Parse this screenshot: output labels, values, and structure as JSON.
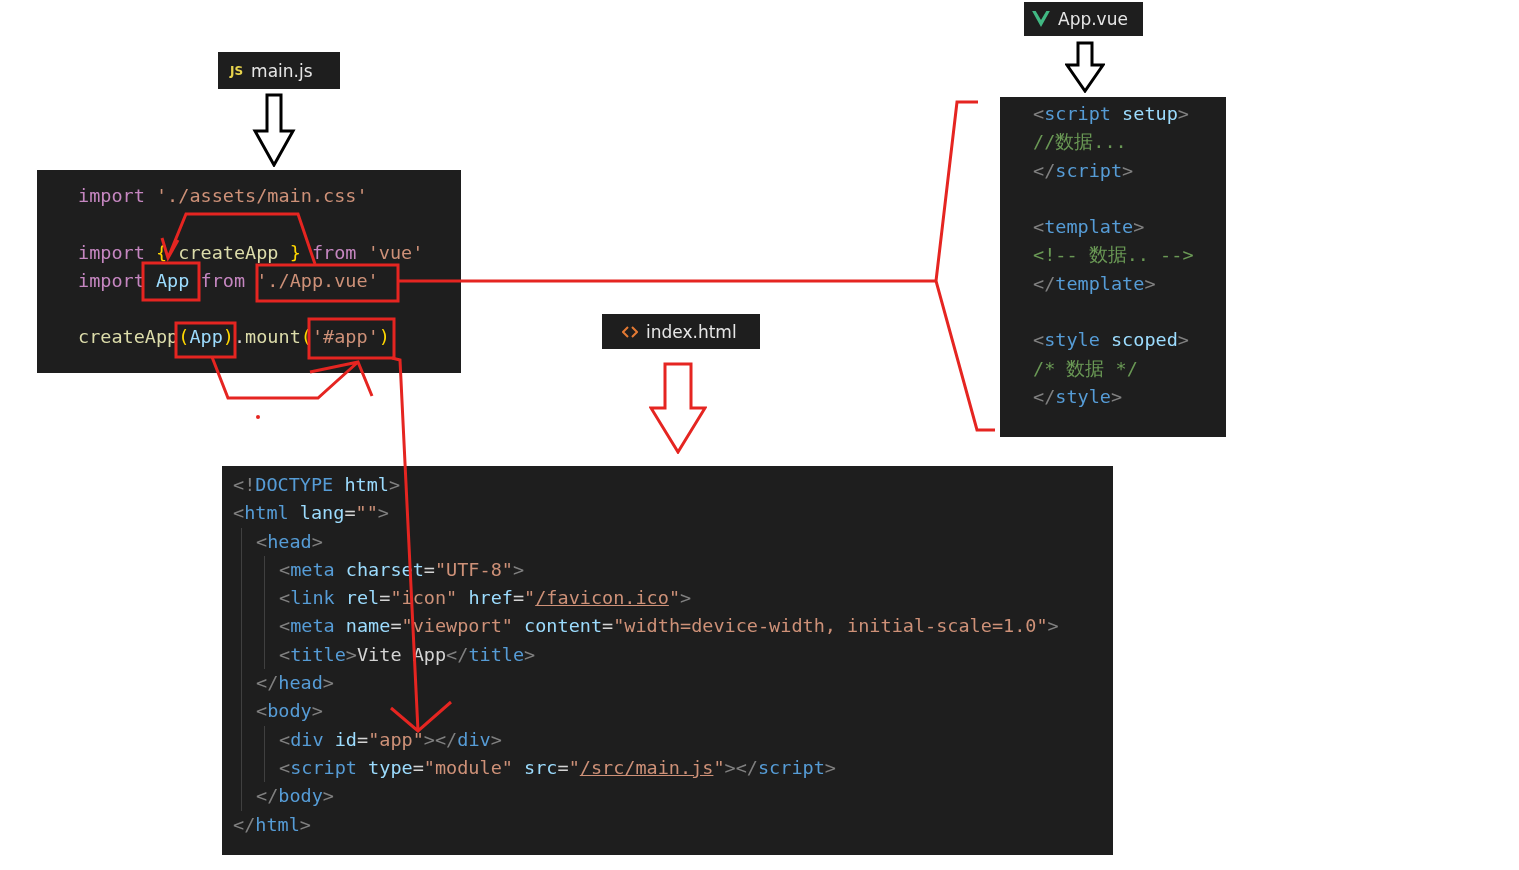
{
  "files": [
    {
      "tab": {
        "name": "main.js",
        "icon_text": "JS"
      },
      "lines": [
        {
          "kind": "code",
          "words": [
            [
              {
                "kind": "keyword",
                "text": "import"
              }
            ],
            [
              {
                "kind": "string",
                "text": "'./assets/main.css'"
              }
            ]
          ]
        },
        {
          "kind": "blank"
        },
        {
          "kind": "code",
          "words": [
            [
              {
                "kind": "keyword",
                "text": "import"
              }
            ],
            [
              {
                "kind": "brace",
                "text": "{"
              }
            ],
            [
              {
                "kind": "function",
                "text": "createApp"
              }
            ],
            [
              {
                "kind": "brace",
                "text": "}"
              }
            ],
            [
              {
                "kind": "keyword",
                "text": "from"
              }
            ],
            [
              {
                "kind": "string",
                "text": "'vue'"
              }
            ]
          ]
        },
        {
          "kind": "code",
          "words": [
            [
              {
                "kind": "keyword",
                "text": "import"
              }
            ],
            [
              {
                "kind": "variable",
                "text": "App"
              }
            ],
            [
              {
                "kind": "keyword",
                "text": "from"
              }
            ],
            [
              {
                "kind": "string",
                "text": "'./App.vue'"
              }
            ]
          ]
        },
        {
          "kind": "blank"
        },
        {
          "kind": "code",
          "words": [
            [
              {
                "kind": "function",
                "text": "createApp"
              },
              {
                "kind": "brace",
                "text": "("
              },
              {
                "kind": "variable",
                "text": "App"
              },
              {
                "kind": "brace",
                "text": ")"
              },
              {
                "kind": "plain",
                "text": "."
              },
              {
                "kind": "function",
                "text": "mount"
              },
              {
                "kind": "brace",
                "text": "("
              },
              {
                "kind": "string",
                "text": "'#app'"
              },
              {
                "kind": "brace",
                "text": ")"
              }
            ]
          ]
        }
      ]
    },
    {
      "tab": {
        "name": "App.vue"
      },
      "lines": [
        {
          "kind": "code",
          "words": [
            [
              {
                "kind": "bracket",
                "text": "<"
              },
              {
                "kind": "tag",
                "text": "script"
              }
            ],
            [
              {
                "kind": "attr",
                "text": "setup"
              },
              {
                "kind": "bracket",
                "text": ">"
              }
            ]
          ]
        },
        {
          "kind": "code",
          "words": [
            [
              {
                "kind": "comment",
                "text": "//数据..."
              }
            ]
          ]
        },
        {
          "kind": "code",
          "words": [
            [
              {
                "kind": "bracket",
                "text": "</"
              },
              {
                "kind": "tag",
                "text": "script"
              },
              {
                "kind": "bracket",
                "text": ">"
              }
            ]
          ]
        },
        {
          "kind": "blank"
        },
        {
          "kind": "code",
          "words": [
            [
              {
                "kind": "bracket",
                "text": "<"
              },
              {
                "kind": "tag",
                "text": "template"
              },
              {
                "kind": "bracket",
                "text": ">"
              }
            ]
          ]
        },
        {
          "kind": "code",
          "words": [
            [
              {
                "kind": "comment",
                "text": "<!-- 数据.. -->"
              }
            ]
          ]
        },
        {
          "kind": "code",
          "words": [
            [
              {
                "kind": "bracket",
                "text": "</"
              },
              {
                "kind": "tag",
                "text": "template"
              },
              {
                "kind": "bracket",
                "text": ">"
              }
            ]
          ]
        },
        {
          "kind": "blank"
        },
        {
          "kind": "code",
          "words": [
            [
              {
                "kind": "bracket",
                "text": "<"
              },
              {
                "kind": "tag",
                "text": "style"
              }
            ],
            [
              {
                "kind": "attr",
                "text": "scoped"
              },
              {
                "kind": "bracket",
                "text": ">"
              }
            ]
          ]
        },
        {
          "kind": "code",
          "words": [
            [
              {
                "kind": "comment",
                "text": "/* 数据 */"
              }
            ]
          ]
        },
        {
          "kind": "code",
          "words": [
            [
              {
                "kind": "bracket",
                "text": "</"
              },
              {
                "kind": "tag",
                "text": "style"
              },
              {
                "kind": "bracket",
                "text": ">"
              }
            ]
          ]
        }
      ]
    },
    {
      "tab": {
        "name": "index.html"
      },
      "lines": [
        {
          "kind": "code",
          "words": [
            [
              {
                "kind": "bracket",
                "text": "<!"
              },
              {
                "kind": "tag",
                "text": "DOCTYPE"
              }
            ],
            [
              {
                "kind": "attr",
                "text": "html"
              },
              {
                "kind": "bracket",
                "text": ">"
              }
            ]
          ]
        },
        {
          "kind": "code",
          "words": [
            [
              {
                "kind": "bracket",
                "text": "<"
              },
              {
                "kind": "tag",
                "text": "html"
              }
            ],
            [
              {
                "kind": "attr",
                "text": "lang"
              },
              {
                "kind": "plain",
                "text": "="
              },
              {
                "kind": "string",
                "text": "\"\""
              },
              {
                "kind": "bracket",
                "text": ">"
              }
            ]
          ],
          "children": [
            {
              "kind": "code",
              "words": [
                [
                  {
                    "kind": "bracket",
                    "text": "<"
                  },
                  {
                    "kind": "tag",
                    "text": "head"
                  },
                  {
                    "kind": "bracket",
                    "text": ">"
                  }
                ]
              ],
              "children": [
                {
                  "kind": "code",
                  "words": [
                    [
                      {
                        "kind": "bracket",
                        "text": "<"
                      },
                      {
                        "kind": "tag",
                        "text": "meta"
                      }
                    ],
                    [
                      {
                        "kind": "attr",
                        "text": "charset"
                      },
                      {
                        "kind": "plain",
                        "text": "="
                      },
                      {
                        "kind": "string",
                        "text": "\"UTF-8\""
                      },
                      {
                        "kind": "bracket",
                        "text": ">"
                      }
                    ]
                  ]
                },
                {
                  "kind": "code",
                  "words": [
                    [
                      {
                        "kind": "bracket",
                        "text": "<"
                      },
                      {
                        "kind": "tag",
                        "text": "link"
                      }
                    ],
                    [
                      {
                        "kind": "attr",
                        "text": "rel"
                      },
                      {
                        "kind": "plain",
                        "text": "="
                      },
                      {
                        "kind": "string",
                        "text": "\"icon\""
                      }
                    ],
                    [
                      {
                        "kind": "attr",
                        "text": "href"
                      },
                      {
                        "kind": "plain",
                        "text": "="
                      },
                      {
                        "kind": "string",
                        "text": "\""
                      },
                      {
                        "kind": "link",
                        "text": "/favicon.ico"
                      },
                      {
                        "kind": "string",
                        "text": "\""
                      },
                      {
                        "kind": "bracket",
                        "text": ">"
                      }
                    ]
                  ]
                },
                {
                  "kind": "code",
                  "words": [
                    [
                      {
                        "kind": "bracket",
                        "text": "<"
                      },
                      {
                        "kind": "tag",
                        "text": "meta"
                      }
                    ],
                    [
                      {
                        "kind": "attr",
                        "text": "name"
                      },
                      {
                        "kind": "plain",
                        "text": "="
                      },
                      {
                        "kind": "string",
                        "text": "\"viewport\""
                      }
                    ],
                    [
                      {
                        "kind": "attr",
                        "text": "content"
                      },
                      {
                        "kind": "plain",
                        "text": "="
                      },
                      {
                        "kind": "string",
                        "text": "\"width=device-width,"
                      }
                    ],
                    [
                      {
                        "kind": "string",
                        "text": "initial-scale=1.0\""
                      },
                      {
                        "kind": "bracket",
                        "text": ">"
                      }
                    ]
                  ]
                },
                {
                  "kind": "code",
                  "words": [
                    [
                      {
                        "kind": "bracket",
                        "text": "<"
                      },
                      {
                        "kind": "tag",
                        "text": "title"
                      },
                      {
                        "kind": "bracket",
                        "text": ">"
                      },
                      {
                        "kind": "plain",
                        "text": "Vite"
                      }
                    ],
                    [
                      {
                        "kind": "plain",
                        "text": "App"
                      },
                      {
                        "kind": "bracket",
                        "text": "</"
                      },
                      {
                        "kind": "tag",
                        "text": "title"
                      },
                      {
                        "kind": "bracket",
                        "text": ">"
                      }
                    ]
                  ]
                }
              ]
            },
            {
              "kind": "code",
              "words": [
                [
                  {
                    "kind": "bracket",
                    "text": "</"
                  },
                  {
                    "kind": "tag",
                    "text": "head"
                  },
                  {
                    "kind": "bracket",
                    "text": ">"
                  }
                ]
              ]
            },
            {
              "kind": "code",
              "words": [
                [
                  {
                    "kind": "bracket",
                    "text": "<"
                  },
                  {
                    "kind": "tag",
                    "text": "body"
                  },
                  {
                    "kind": "bracket",
                    "text": ">"
                  }
                ]
              ],
              "children": [
                {
                  "kind": "code",
                  "words": [
                    [
                      {
                        "kind": "bracket",
                        "text": "<"
                      },
                      {
                        "kind": "tag",
                        "text": "div"
                      }
                    ],
                    [
                      {
                        "kind": "attr",
                        "text": "id"
                      },
                      {
                        "kind": "plain",
                        "text": "="
                      },
                      {
                        "kind": "string",
                        "text": "\"app\""
                      },
                      {
                        "kind": "bracket",
                        "text": "></"
                      },
                      {
                        "kind": "tag",
                        "text": "div"
                      },
                      {
                        "kind": "bracket",
                        "text": ">"
                      }
                    ]
                  ]
                },
                {
                  "kind": "code",
                  "words": [
                    [
                      {
                        "kind": "bracket",
                        "text": "<"
                      },
                      {
                        "kind": "tag",
                        "text": "script"
                      }
                    ],
                    [
                      {
                        "kind": "attr",
                        "text": "type"
                      },
                      {
                        "kind": "plain",
                        "text": "="
                      },
                      {
                        "kind": "string",
                        "text": "\"module\""
                      }
                    ],
                    [
                      {
                        "kind": "attr",
                        "text": "src"
                      },
                      {
                        "kind": "plain",
                        "text": "="
                      },
                      {
                        "kind": "string",
                        "text": "\""
                      },
                      {
                        "kind": "link",
                        "text": "/src/main.js"
                      },
                      {
                        "kind": "string",
                        "text": "\""
                      },
                      {
                        "kind": "bracket",
                        "text": "></"
                      },
                      {
                        "kind": "tag",
                        "text": "script"
                      },
                      {
                        "kind": "bracket",
                        "text": ">"
                      }
                    ]
                  ]
                }
              ]
            },
            {
              "kind": "code",
              "words": [
                [
                  {
                    "kind": "bracket",
                    "text": "</"
                  },
                  {
                    "kind": "tag",
                    "text": "body"
                  },
                  {
                    "kind": "bracket",
                    "text": ">"
                  }
                ]
              ]
            }
          ]
        },
        {
          "kind": "code",
          "words": [
            [
              {
                "kind": "bracket",
                "text": "</"
              },
              {
                "kind": "tag",
                "text": "html"
              },
              {
                "kind": "bracket",
                "text": ">"
              }
            ]
          ]
        }
      ]
    }
  ]
}
